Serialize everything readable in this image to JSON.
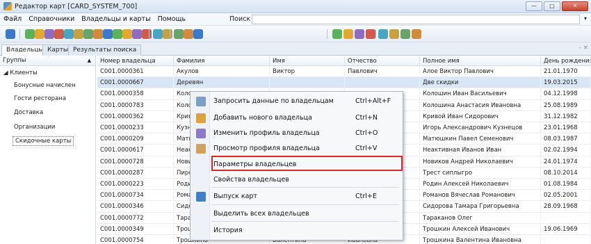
{
  "window": {
    "title": "Редактор карт [CARD_SYSTEM_700]",
    "buttons": {
      "minimize": "—",
      "maximize": "□",
      "close": "✕"
    }
  },
  "menu": {
    "items": [
      "Файл",
      "Справочники",
      "Владельцы и карты",
      "Помощь"
    ],
    "search_label": "Поиск",
    "search_value": ""
  },
  "toolbar": {
    "icons": [
      "save-icon",
      "check-icon",
      "globe-icon",
      "user-icon",
      "card-icon",
      "edit-icon",
      "tag-icon",
      "tool-icon",
      "gift-icon",
      "list-icon",
      "cube-icon",
      "person-icon",
      "target-icon",
      "report-icon",
      "history-icon",
      "refresh-icon",
      "smile-icon",
      "users-icon",
      "settings-icon",
      "grid-icon",
      "people-icon",
      "people-add-icon",
      "people-remove-icon",
      "people-list-icon",
      "people-star-icon",
      "people-export-icon",
      "people-find-icon"
    ]
  },
  "tabs": [
    "Владельцы",
    "Карты",
    "Результаты поиска"
  ],
  "tab_close": "- ×",
  "left_panel": {
    "header": "Группы",
    "sort_indicator": "▲",
    "root": "◢ Клиенты",
    "children": [
      "Бонусные начислен",
      "Гости ресторана",
      "Доставка",
      "Организации",
      "Скидочные карты"
    ]
  },
  "grid": {
    "columns": [
      "Номер владельца",
      "Фамилия",
      "Имя",
      "Отчество",
      "Полное имя",
      "День рождения"
    ],
    "rows": [
      [
        "C001.0000361",
        "Акулов",
        "Виктор",
        "Павлович",
        "Алое Виктор Павлович",
        "21.01.1970"
      ],
      [
        "C001.0000667",
        "Деревян",
        "",
        "",
        "Две скидки",
        "19.03.2015"
      ],
      [
        "C001.0000358",
        "Колошин",
        "",
        "",
        "Колошин Иван Васильевич",
        "04.12.1998"
      ],
      [
        "C001.0000783",
        "Колошин",
        "",
        "",
        "Колошина Анастасия Ивановна",
        "25.08.1989"
      ],
      [
        "C001.0000362",
        "Кривой",
        "",
        "",
        "Кривой Иван Сидорович",
        "31.12.1982"
      ],
      [
        "C001.0000233",
        "Кузнецо",
        "",
        "",
        "Игорь Александрович Кузнецов",
        "23.01.1968"
      ],
      [
        "C001.0000209",
        "Матюшка",
        "",
        "",
        "Матюшкин Павел Семенович",
        "08.03.1987"
      ],
      [
        "C001.0000617",
        "Неактив",
        "",
        "",
        "Неактивная Иванов Иван",
        "02.02.1994"
      ],
      [
        "C001.0000728",
        "Новиков",
        "",
        "",
        "Новиков Андрей Николаевич",
        "24.01.1974"
      ],
      [
        "C001.0000287",
        "Пирогов",
        "",
        "",
        "Трест сиплыгро",
        "08.10.2014"
      ],
      [
        "C001.0000223",
        "Родин",
        "",
        "",
        "Родин Алексей Николаевич",
        "01.08.1984"
      ],
      [
        "C001.0000734",
        "Романов",
        "",
        "",
        "Романов Вячеслав Романович",
        "02.05.2001"
      ],
      [
        "C001.0000346",
        "Сидоров",
        "",
        "",
        "Сидорова Тамара Григорьевна",
        "28.09.1968"
      ],
      [
        "C001.0000772",
        "Таракано",
        "",
        "",
        "Тараканов Олег",
        ""
      ],
      [
        "C001.0000349",
        "Трошкин",
        "",
        "",
        "Трошкин Алексей Иванович",
        "19.06.1969"
      ],
      [
        "C001.0000754",
        "Трошкина",
        "Валентина",
        "Ивановна",
        "Трошкина Валентина Ивановна",
        ""
      ]
    ]
  },
  "context_menu": {
    "items": [
      {
        "label": "Запросить данные по владельцам",
        "shortcut": "Ctrl+Alt+F",
        "icon": "request-data-icon",
        "color": "#7aa0c8"
      },
      {
        "label": "Добавить нового владельца",
        "shortcut": "Ctrl+N",
        "icon": "add-user-icon",
        "color": "#e0a040"
      },
      {
        "label": "Изменить профиль владельца",
        "shortcut": "Ctrl+O",
        "icon": "edit-user-icon",
        "color": "#8a7ac8"
      },
      {
        "label": "Просмотр профиля владельца",
        "shortcut": "Ctrl+V",
        "icon": "view-user-icon",
        "color": "#d4a060"
      },
      {
        "label": "Параметры владельцев",
        "shortcut": "",
        "icon": "",
        "color": ""
      },
      {
        "label": "Свойства владельцев",
        "shortcut": "",
        "icon": "",
        "color": ""
      },
      {
        "label": "Выпуск карт",
        "shortcut": "Ctrl+E",
        "icon": "issue-cards-icon",
        "color": "#3f7fc8"
      },
      {
        "label": "Выделить всех владельцев",
        "shortcut": "",
        "icon": "",
        "color": ""
      },
      {
        "label": "История",
        "shortcut": "",
        "icon": "",
        "color": ""
      }
    ],
    "highlight_color": "#d9262c"
  }
}
